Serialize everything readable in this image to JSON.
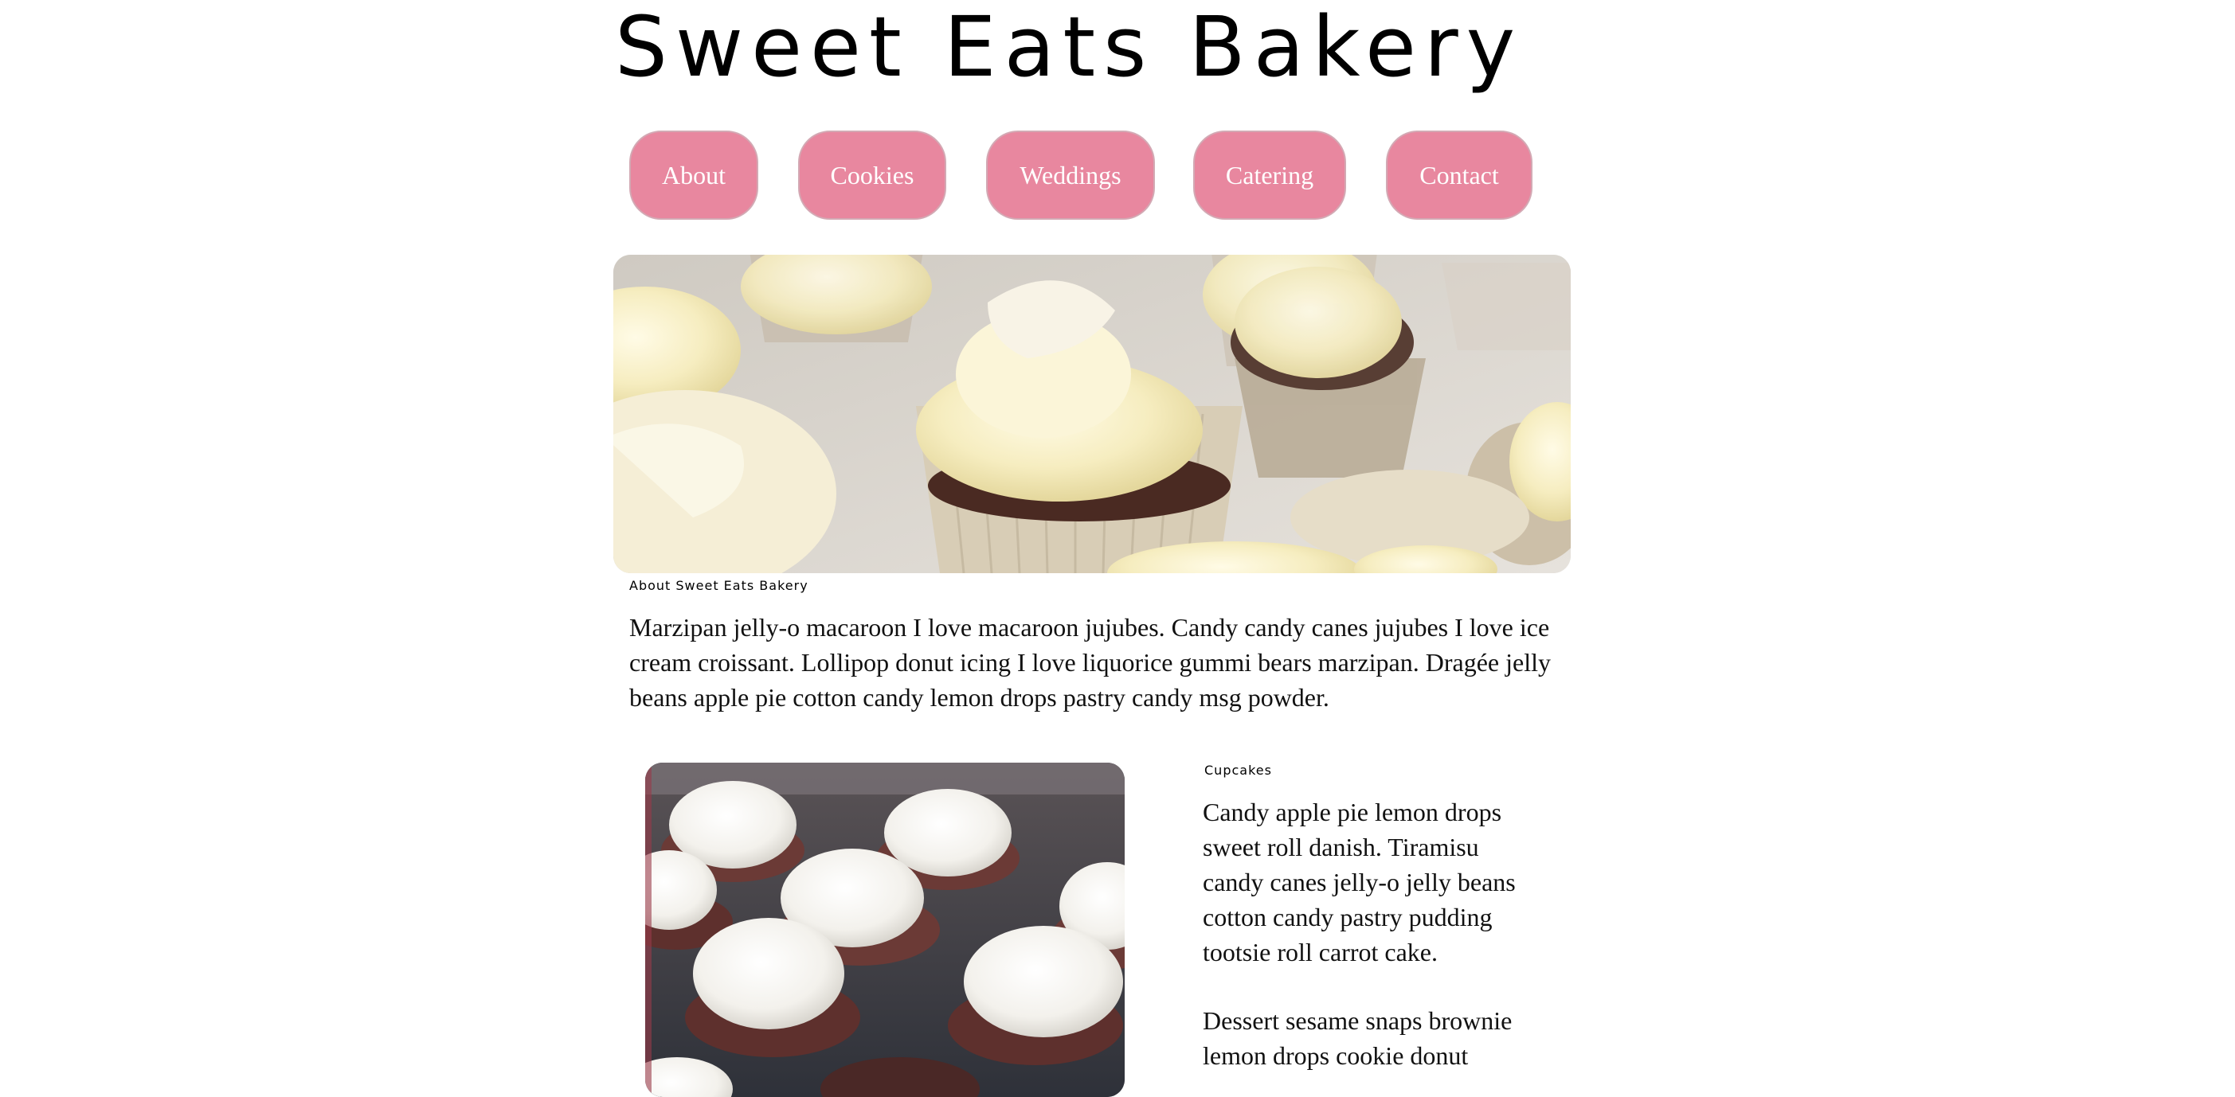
{
  "header": {
    "title": "Sweet Eats Bakery"
  },
  "nav": {
    "items": [
      {
        "label": "About"
      },
      {
        "label": "Cookies"
      },
      {
        "label": "Weddings"
      },
      {
        "label": "Catering"
      },
      {
        "label": "Contact"
      }
    ]
  },
  "about": {
    "caption": "About Sweet Eats Bakery",
    "text": "Marzipan jelly-o macaroon I love macaroon jujubes. Candy candy canes jujubes I love ice cream croissant. Lollipop donut icing I love liquorice gummi bears marzipan. Dragée jelly beans apple pie cotton candy lemon drops pastry candy msg powder."
  },
  "cupcakes": {
    "caption": "Cupcakes",
    "paragraphs": [
      "Candy apple pie lemon drops sweet roll danish. Tiramisu candy canes jelly-o jelly beans cotton candy pastry pudding tootsie roll carrot cake.",
      "Dessert sesame snaps brownie lemon drops cookie donut"
    ]
  },
  "colors": {
    "nav_button_bg": "#e8879f",
    "nav_button_text": "#ffffff",
    "frosting": "#f6efc6"
  },
  "images": {
    "hero": "cupcakes-with-cream-frosting-photo",
    "cupcakes": "chocolate-cupcakes-tray-photo"
  }
}
